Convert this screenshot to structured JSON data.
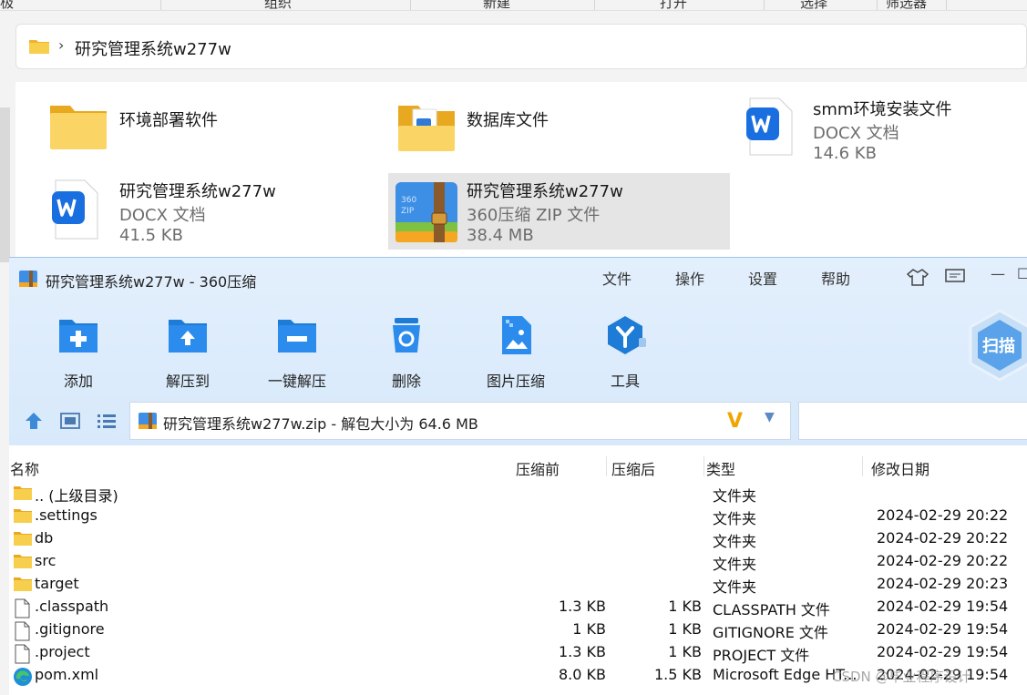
{
  "explorer": {
    "top_items": [
      "极",
      "组织",
      "新建",
      "打开",
      "选择",
      "筛选器"
    ],
    "breadcrumb": "研究管理系统w277w",
    "items": [
      {
        "name": "环境部署软件",
        "type": "",
        "size": ""
      },
      {
        "name": "数据库文件",
        "type": "",
        "size": ""
      },
      {
        "name": "smm环境安装文件",
        "type": "DOCX 文档",
        "size": "14.6 KB"
      },
      {
        "name": "研究管理系统w277w",
        "type": "DOCX 文档",
        "size": "41.5 KB"
      },
      {
        "name": "研究管理系统w277w",
        "type": "360压缩 ZIP 文件",
        "size": "38.4 MB"
      }
    ]
  },
  "zip_window": {
    "title": "研究管理系统w277w - 360压缩",
    "menu": [
      "文件",
      "操作",
      "设置",
      "帮助"
    ],
    "toolbar": [
      "添加",
      "解压到",
      "一键解压",
      "删除",
      "图片压缩",
      "工具"
    ],
    "scan_label": "扫描",
    "path_text": "研究管理系统w277w.zip - 解包大小为 64.6 MB",
    "columns": [
      "名称",
      "压缩前",
      "压缩后",
      "类型",
      "修改日期"
    ],
    "rows": [
      {
        "icon": "folder",
        "name": ".. (上级目录)",
        "orig": "",
        "comp": "",
        "type": "文件夹",
        "date": ""
      },
      {
        "icon": "folder",
        "name": ".settings",
        "orig": "",
        "comp": "",
        "type": "文件夹",
        "date": "2024-02-29 20:22"
      },
      {
        "icon": "folder",
        "name": "db",
        "orig": "",
        "comp": "",
        "type": "文件夹",
        "date": "2024-02-29 20:22"
      },
      {
        "icon": "folder",
        "name": "src",
        "orig": "",
        "comp": "",
        "type": "文件夹",
        "date": "2024-02-29 20:22"
      },
      {
        "icon": "folder",
        "name": "target",
        "orig": "",
        "comp": "",
        "type": "文件夹",
        "date": "2024-02-29 20:23"
      },
      {
        "icon": "file",
        "name": ".classpath",
        "orig": "1.3 KB",
        "comp": "1 KB",
        "type": "CLASSPATH 文件",
        "date": "2024-02-29 19:54"
      },
      {
        "icon": "file",
        "name": ".gitignore",
        "orig": "1 KB",
        "comp": "1 KB",
        "type": "GITIGNORE 文件",
        "date": "2024-02-29 19:54"
      },
      {
        "icon": "file",
        "name": ".project",
        "orig": "1.3 KB",
        "comp": "1 KB",
        "type": "PROJECT 文件",
        "date": "2024-02-29 19:54"
      },
      {
        "icon": "edge",
        "name": "pom.xml",
        "orig": "8.0 KB",
        "comp": "1.5 KB",
        "type": "Microsoft Edge HT...",
        "date": "2024-02-29 19:54"
      }
    ]
  },
  "watermark": "CSDN @毕业程序设计",
  "colors": {
    "accent": "#1e7bd6",
    "folder": "#f5c33b",
    "selection": "#e5e5e5",
    "header_bg": "#dcebfb"
  }
}
